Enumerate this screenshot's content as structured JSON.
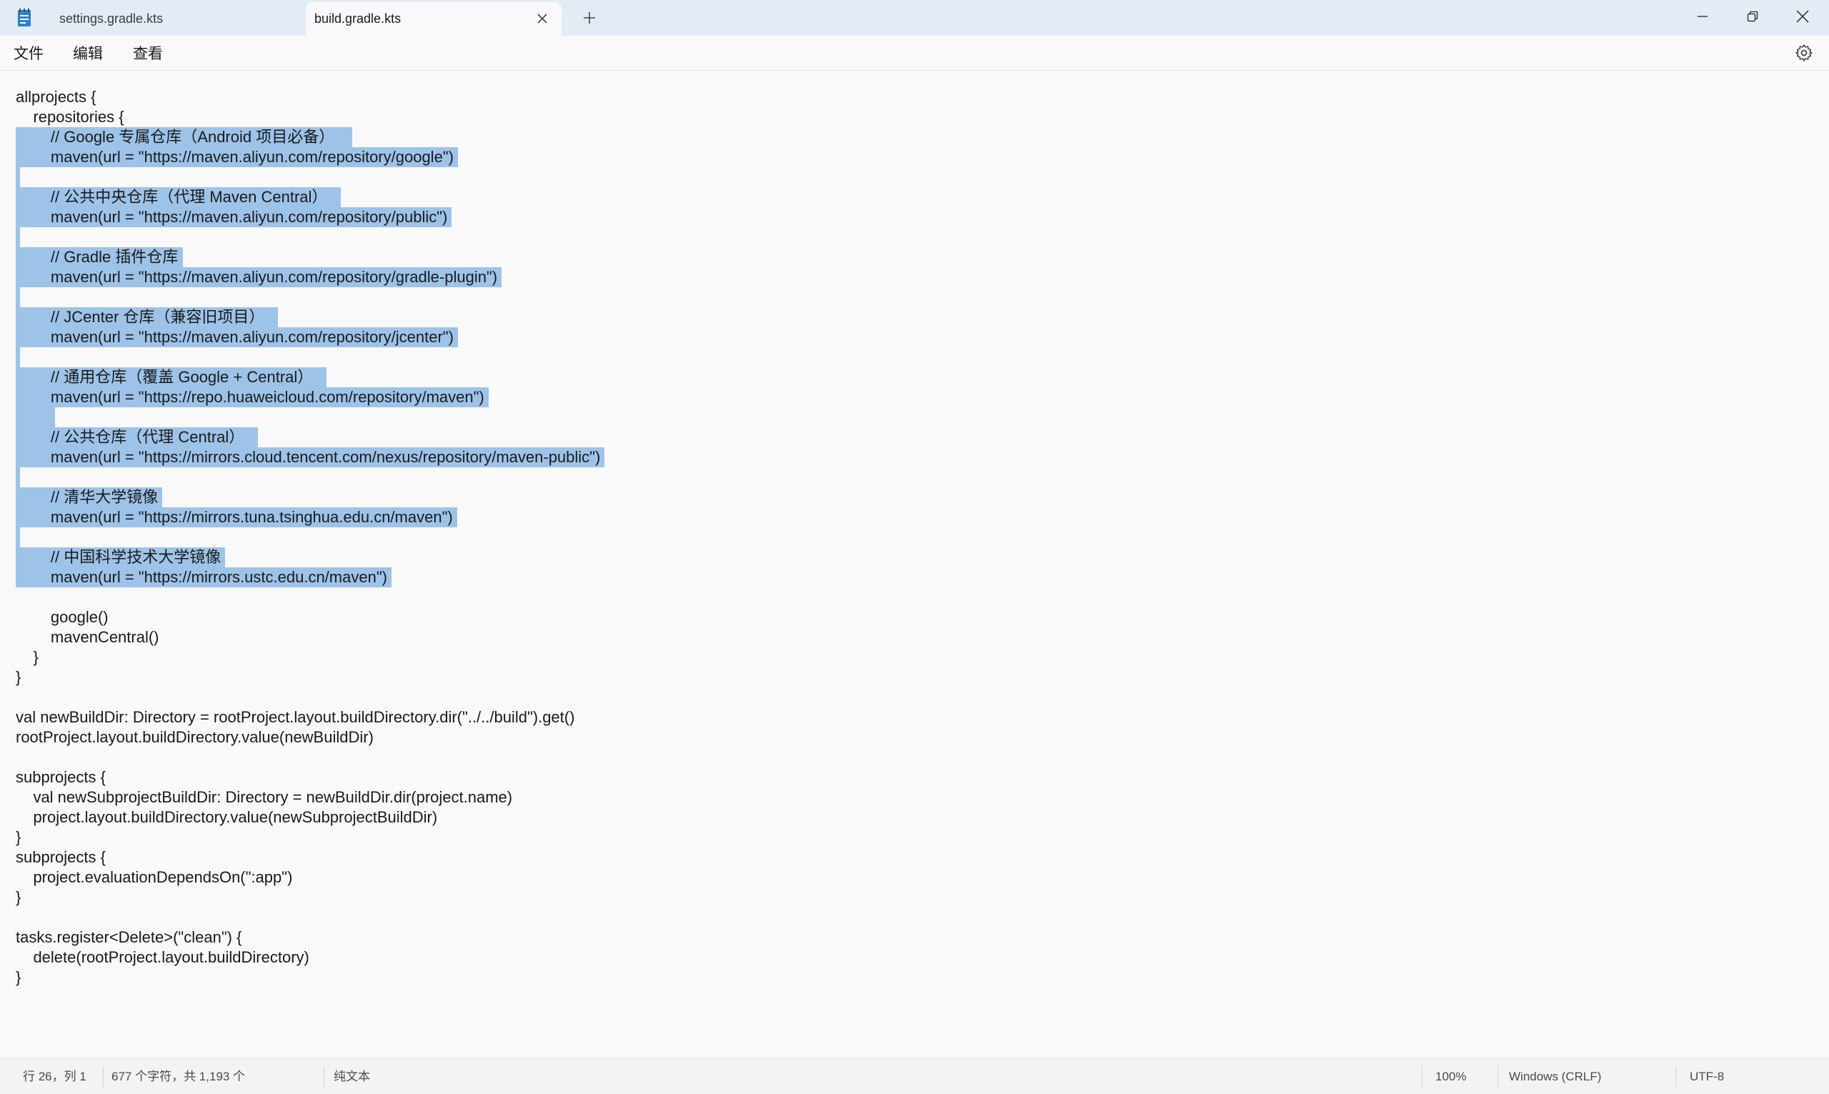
{
  "tabs": [
    {
      "label": "settings.gradle.kts",
      "active": false
    },
    {
      "label": "build.gradle.kts",
      "active": true
    }
  ],
  "menu": [
    "文件",
    "编辑",
    "查看"
  ],
  "icons": {
    "app": "notepad-icon",
    "close_tab": "close-icon",
    "new_tab": "plus-icon",
    "minimize": "minimize-icon",
    "restore": "restore-icon",
    "close_window": "close-icon",
    "settings": "gear-icon"
  },
  "colors": {
    "selection": "#9dc3e9",
    "titlebar": "#e3ebf4",
    "editor_bg": "#f9f9f9"
  },
  "code_lines": [
    {
      "pre": "allprojects {",
      "sel": "",
      "post": "",
      "pad": ""
    },
    {
      "pre": "    repositories {",
      "sel": "",
      "post": "",
      "pad": ""
    },
    {
      "pre": "",
      "sel": "        // Google 专属仓库（Android 项目必备）",
      "post": "",
      "pad": "    "
    },
    {
      "pre": "",
      "sel": "        maven(url = \"https://maven.aliyun.com/repository/google\")",
      "post": "",
      "pad": " "
    },
    {
      "pre": "",
      "sel": "",
      "post": "",
      "pad": " "
    },
    {
      "pre": "",
      "sel": "        // 公共中央仓库（代理 Maven Central）",
      "post": "",
      "pad": "   "
    },
    {
      "pre": "",
      "sel": "        maven(url = \"https://maven.aliyun.com/repository/public\")",
      "post": "",
      "pad": " "
    },
    {
      "pre": "",
      "sel": "",
      "post": "",
      "pad": " "
    },
    {
      "pre": "",
      "sel": "        // Gradle 插件仓库",
      "post": "",
      "pad": " "
    },
    {
      "pre": "",
      "sel": "        maven(url = \"https://maven.aliyun.com/repository/gradle-plugin\")",
      "post": "",
      "pad": " "
    },
    {
      "pre": "",
      "sel": "",
      "post": "",
      "pad": " "
    },
    {
      "pre": "",
      "sel": "        // JCenter 仓库（兼容旧项目）",
      "post": "",
      "pad": "   "
    },
    {
      "pre": "",
      "sel": "        maven(url = \"https://maven.aliyun.com/repository/jcenter\")",
      "post": "",
      "pad": " "
    },
    {
      "pre": "",
      "sel": "",
      "post": "",
      "pad": " "
    },
    {
      "pre": "",
      "sel": "        // 通用仓库（覆盖 Google + Central）",
      "post": "",
      "pad": "   "
    },
    {
      "pre": "",
      "sel": "        maven(url = \"https://repo.huaweicloud.com/repository/maven\")",
      "post": "",
      "pad": " "
    },
    {
      "pre": "",
      "sel": "        ",
      "post": "",
      "pad": " "
    },
    {
      "pre": "",
      "sel": "        // 公共仓库（代理 Central）",
      "post": "",
      "pad": "   "
    },
    {
      "pre": "",
      "sel": "        maven(url = \"https://mirrors.cloud.tencent.com/nexus/repository/maven-public\")",
      "post": "",
      "pad": " "
    },
    {
      "pre": "",
      "sel": "",
      "post": "",
      "pad": " "
    },
    {
      "pre": "",
      "sel": "        // 清华大学镜像",
      "post": "",
      "pad": " "
    },
    {
      "pre": "",
      "sel": "        maven(url = \"https://mirrors.tuna.tsinghua.edu.cn/maven\")",
      "post": "",
      "pad": " "
    },
    {
      "pre": "",
      "sel": "",
      "post": "",
      "pad": " "
    },
    {
      "pre": "",
      "sel": "        // 中国科学技术大学镜像",
      "post": "",
      "pad": " "
    },
    {
      "pre": "",
      "sel": "        maven(url = \"https://mirrors.ustc.edu.cn/maven\")",
      "post": "",
      "pad": " "
    },
    {
      "pre": "",
      "sel": "",
      "post": "",
      "pad": ""
    },
    {
      "pre": "        google()",
      "sel": "",
      "post": "",
      "pad": ""
    },
    {
      "pre": "        mavenCentral()",
      "sel": "",
      "post": "",
      "pad": ""
    },
    {
      "pre": "    }",
      "sel": "",
      "post": "",
      "pad": ""
    },
    {
      "pre": "}",
      "sel": "",
      "post": "",
      "pad": ""
    },
    {
      "pre": "",
      "sel": "",
      "post": "",
      "pad": ""
    },
    {
      "pre": "val newBuildDir: Directory = rootProject.layout.buildDirectory.dir(\"../../build\").get()",
      "sel": "",
      "post": "",
      "pad": ""
    },
    {
      "pre": "rootProject.layout.buildDirectory.value(newBuildDir)",
      "sel": "",
      "post": "",
      "pad": ""
    },
    {
      "pre": "",
      "sel": "",
      "post": "",
      "pad": ""
    },
    {
      "pre": "subprojects {",
      "sel": "",
      "post": "",
      "pad": ""
    },
    {
      "pre": "    val newSubprojectBuildDir: Directory = newBuildDir.dir(project.name)",
      "sel": "",
      "post": "",
      "pad": ""
    },
    {
      "pre": "    project.layout.buildDirectory.value(newSubprojectBuildDir)",
      "sel": "",
      "post": "",
      "pad": ""
    },
    {
      "pre": "}",
      "sel": "",
      "post": "",
      "pad": ""
    },
    {
      "pre": "subprojects {",
      "sel": "",
      "post": "",
      "pad": ""
    },
    {
      "pre": "    project.evaluationDependsOn(\":app\")",
      "sel": "",
      "post": "",
      "pad": ""
    },
    {
      "pre": "}",
      "sel": "",
      "post": "",
      "pad": ""
    },
    {
      "pre": "",
      "sel": "",
      "post": "",
      "pad": ""
    },
    {
      "pre": "tasks.register<Delete>(\"clean\") {",
      "sel": "",
      "post": "",
      "pad": ""
    },
    {
      "pre": "    delete(rootProject.layout.buildDirectory)",
      "sel": "",
      "post": "",
      "pad": ""
    },
    {
      "pre": "}",
      "sel": "",
      "post": "",
      "pad": ""
    }
  ],
  "status": {
    "position": "行 26，列 1",
    "chars": "677 个字符，共 1,193 个",
    "format": "纯文本",
    "zoom": "100%",
    "line_ending": "Windows (CRLF)",
    "encoding": "UTF-8"
  }
}
